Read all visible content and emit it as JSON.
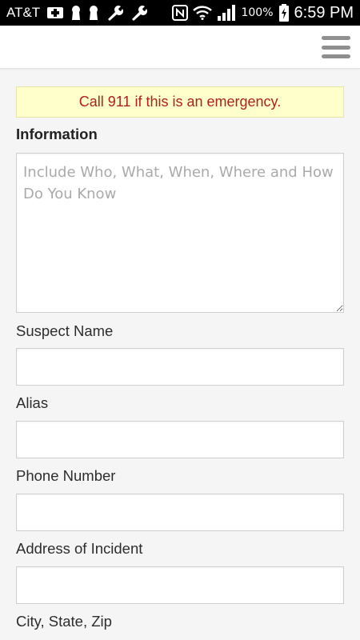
{
  "status_bar": {
    "carrier": "AT&T",
    "icons": [
      "medical-cross-icon",
      "keyhole-icon",
      "keyhole-icon",
      "wrench-icon",
      "wrench-icon",
      "nfc-icon",
      "wifi-icon",
      "signal-icon"
    ],
    "battery_percent": "100%",
    "time": "6:59 PM"
  },
  "header": {
    "menu_icon": "hamburger-menu-icon"
  },
  "alert": {
    "text": "Call 911 if this is an emergency.",
    "background": "#ffffcc",
    "color": "#b0201f"
  },
  "form": {
    "information": {
      "label": "Information",
      "placeholder": "Include Who, What, When, Where and How Do You Know",
      "value": ""
    },
    "suspect_name": {
      "label": "Suspect Name",
      "value": ""
    },
    "alias": {
      "label": "Alias",
      "value": ""
    },
    "phone_number": {
      "label": "Phone Number",
      "value": ""
    },
    "address_of_incident": {
      "label": "Address of Incident",
      "value": ""
    },
    "city_state_zip": {
      "label": "City, State, Zip"
    }
  }
}
